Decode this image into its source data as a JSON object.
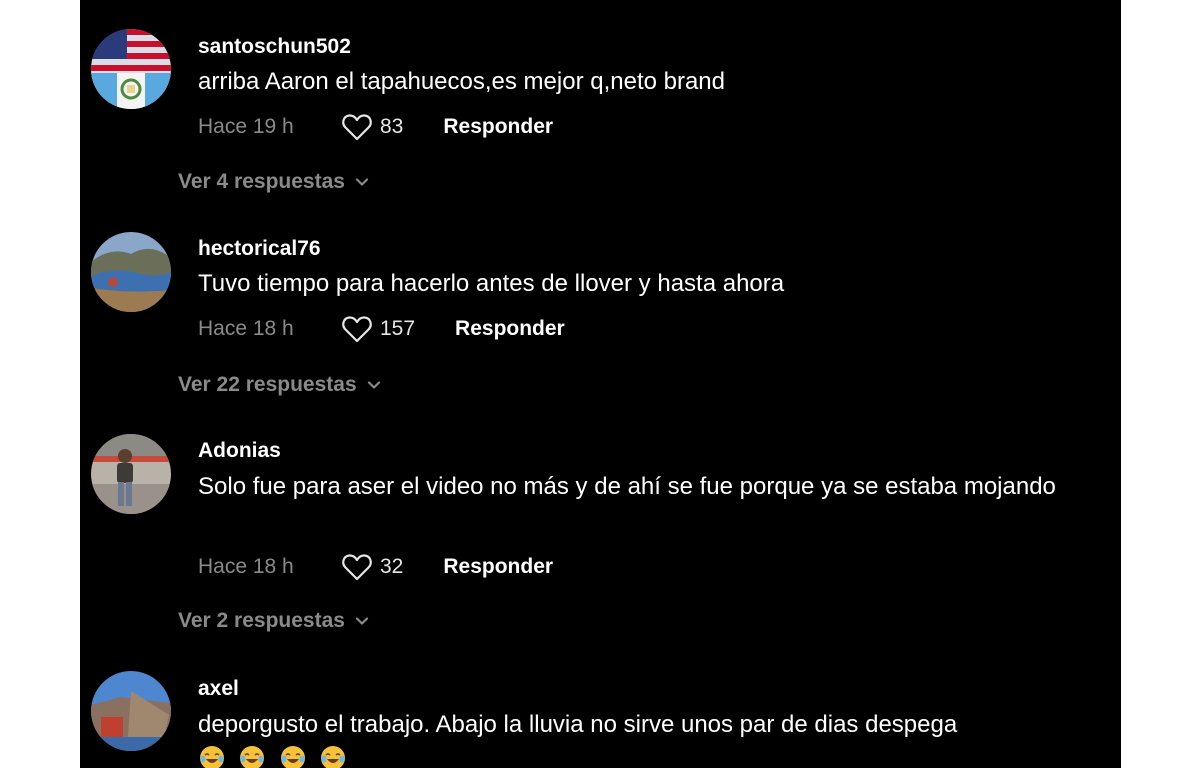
{
  "comments": [
    {
      "username": "santoschun502",
      "text": "arriba Aaron el tapahuecos,es mejor q,neto brand",
      "time": "Hace 19 h",
      "likes": "83",
      "reply_label": "Responder",
      "replies_label": "Ver 4 respuestas"
    },
    {
      "username": "hectorical76",
      "text": "Tuvo tiempo para hacerlo antes de llover y hasta ahora",
      "time": "Hace 18 h",
      "likes": "157",
      "reply_label": "Responder",
      "replies_label": "Ver 22 respuestas"
    },
    {
      "username": "Adonias",
      "text": "Solo fue para aser el video no más y de ahí se fue porque ya se estaba mojando",
      "time": "Hace 18 h",
      "likes": "32",
      "reply_label": "Responder",
      "replies_label": "Ver 2 respuestas"
    },
    {
      "username": "axel",
      "text": "deporgusto el trabajo. Abajo la lluvia no sirve unos par de dias despega",
      "emoji_count": 4
    }
  ],
  "icons": {
    "like": "heart-outline-icon",
    "expand": "chevron-down-icon",
    "emoji": "face-with-tears-of-joy-icon"
  },
  "colors": {
    "background": "#000000",
    "text": "#ffffff",
    "muted": "#8a8a8a"
  }
}
